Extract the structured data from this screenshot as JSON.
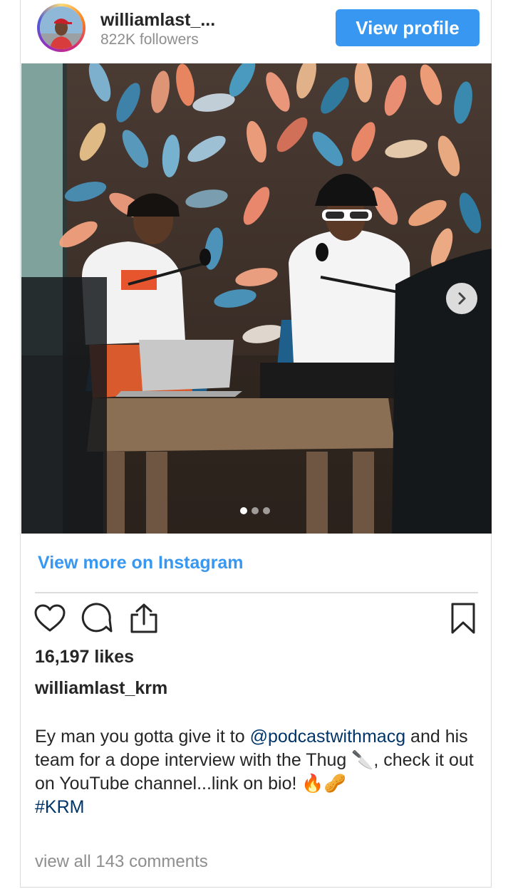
{
  "post": {
    "username_truncated": "williamlast_...",
    "followers": "822K followers",
    "view_profile_label": "View profile",
    "view_more_label": "View more on Instagram",
    "likes": "16,197 likes",
    "caption_username": "williamlast_krm",
    "caption_part1": "Ey man you gotta give it to ",
    "caption_mention": "@podcastwithmacg",
    "caption_part2": " and his team for a dope interview with the Thug 🔪, check it out on YouTube channel...link on bio! 🔥🥜",
    "caption_hashtag": "#KRM",
    "view_comments": "view all 143 comments"
  },
  "carousel": {
    "current_slide": 1,
    "total_slides": 3
  },
  "icons": {
    "like": "heart-icon",
    "comment": "comment-icon",
    "share": "share-icon",
    "save": "bookmark-icon",
    "next": "chevron-right-icon"
  },
  "colors": {
    "accent": "#3897f0",
    "link": "#003569",
    "muted": "#8e8e8e",
    "divider": "#dbdbdb"
  }
}
